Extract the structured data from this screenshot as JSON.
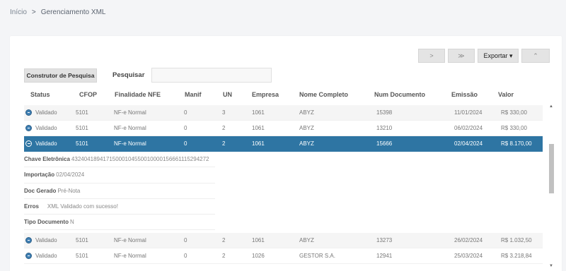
{
  "breadcrumb": {
    "home": "Início",
    "separator": ">",
    "current": "Gerenciamento XML"
  },
  "toolbar": {
    "next_label": ">",
    "last_label": "≫",
    "export_label": "Exportar ▾",
    "collapse_label": "⌃"
  },
  "search": {
    "builder_label": "Construtor de Pesquisa",
    "label": "Pesquisar",
    "value": ""
  },
  "table": {
    "headers": {
      "status": "Status",
      "cfop": "CFOP",
      "finalidade": "Finalidade NFE",
      "manif": "Manif",
      "un": "UN",
      "empresa": "Empresa",
      "nome": "Nome Completo",
      "num": "Num Documento",
      "emissao": "Emissão",
      "valor": "Valor"
    },
    "rows": [
      {
        "status": "Validado",
        "cfop": "5101",
        "finalidade": "NF-e Normal",
        "manif": "0",
        "un": "3",
        "empresa": "1061",
        "nome": "ABYZ",
        "num": "15398",
        "emissao": "11/01/2024",
        "valor": "R$ 330,00"
      },
      {
        "status": "Validado",
        "cfop": "5101",
        "finalidade": "NF-e Normal",
        "manif": "0",
        "un": "2",
        "empresa": "1061",
        "nome": "ABYZ",
        "num": "13210",
        "emissao": "06/02/2024",
        "valor": "R$ 330,00"
      },
      {
        "status": "Validado",
        "cfop": "5101",
        "finalidade": "NF-e Normal",
        "manif": "0",
        "un": "2",
        "empresa": "1061",
        "nome": "ABYZ",
        "num": "15666",
        "emissao": "02/04/2024",
        "valor": "R$ 8.170,00"
      },
      {
        "status": "Validado",
        "cfop": "5101",
        "finalidade": "NF-e Normal",
        "manif": "0",
        "un": "2",
        "empresa": "1061",
        "nome": "ABYZ",
        "num": "13273",
        "emissao": "26/02/2024",
        "valor": "R$ 1.032,50"
      },
      {
        "status": "Validado",
        "cfop": "5101",
        "finalidade": "NF-e Normal",
        "manif": "0",
        "un": "2",
        "empresa": "1026",
        "nome": "GESTOR S.A.",
        "num": "12941",
        "emissao": "25/03/2024",
        "valor": "R$ 3.218,84"
      }
    ],
    "details": {
      "chave_label": "Chave Eletrônica",
      "chave_value": "43240418941715000104550010000156661115294272",
      "importacao_label": "Importação",
      "importacao_value": "02/04/2024",
      "doc_label": "Doc Gerado",
      "doc_value": "Pré-Nota",
      "erros_label": "Erros",
      "erros_value": "XML Validado com sucesso!",
      "tipo_label": "Tipo Documento",
      "tipo_value": "N"
    }
  },
  "colors": {
    "selected_row": "#2e75a3",
    "status_icon": "#3f7fb3"
  }
}
